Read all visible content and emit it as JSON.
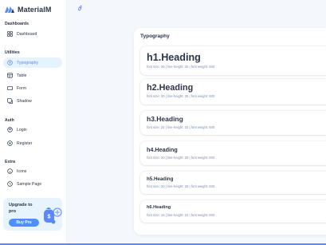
{
  "brand": {
    "name": "MaterialM"
  },
  "sidebar": {
    "sections": [
      {
        "label": "Dashboards"
      },
      {
        "label": "Utilities"
      },
      {
        "label": "Auth"
      },
      {
        "label": "Extra"
      }
    ],
    "items": [
      {
        "label": "Dashboard",
        "icon": "dashboard-icon"
      },
      {
        "label": "Typography",
        "icon": "typography-icon",
        "active": true
      },
      {
        "label": "Table",
        "icon": "table-icon"
      },
      {
        "label": "Form",
        "icon": "form-icon"
      },
      {
        "label": "Shadow",
        "icon": "shadow-icon"
      },
      {
        "label": "Login",
        "icon": "login-icon"
      },
      {
        "label": "Register",
        "icon": "register-icon"
      },
      {
        "label": "Icons",
        "icon": "icons-icon"
      },
      {
        "label": "Sample Page",
        "icon": "sample-page-icon"
      }
    ],
    "upgrade": {
      "title": "Upgrade to pro",
      "button_label": "Buy Pro"
    }
  },
  "page": {
    "card_title": "Typography",
    "headings": [
      {
        "text": "h1.Heading",
        "meta": "font size: 36 | line-height: 40 | font weight: 600"
      },
      {
        "text": "h2.Heading",
        "meta": "font size: 30 | line-height: 36 | font weight: 600"
      },
      {
        "text": "h3.Heading",
        "meta": "font size: 24 | line-height: 32 | font weight: 600"
      },
      {
        "text": "h4.Heading",
        "meta": "font size: 20 | line-height: 28 | font weight: 600"
      },
      {
        "text": "h5.Heading",
        "meta": "font size: 20 | line-height: 28 | font weight: 600"
      },
      {
        "text": "h6.Heading",
        "meta": "font size: 16 | line-height: 24 | font weight: 600"
      }
    ]
  },
  "colors": {
    "accent": "#5d87ff",
    "active_bg": "#e5f3fd",
    "text": "#2a3547",
    "muted": "#7c8fac",
    "button": "#4d8ffc"
  }
}
